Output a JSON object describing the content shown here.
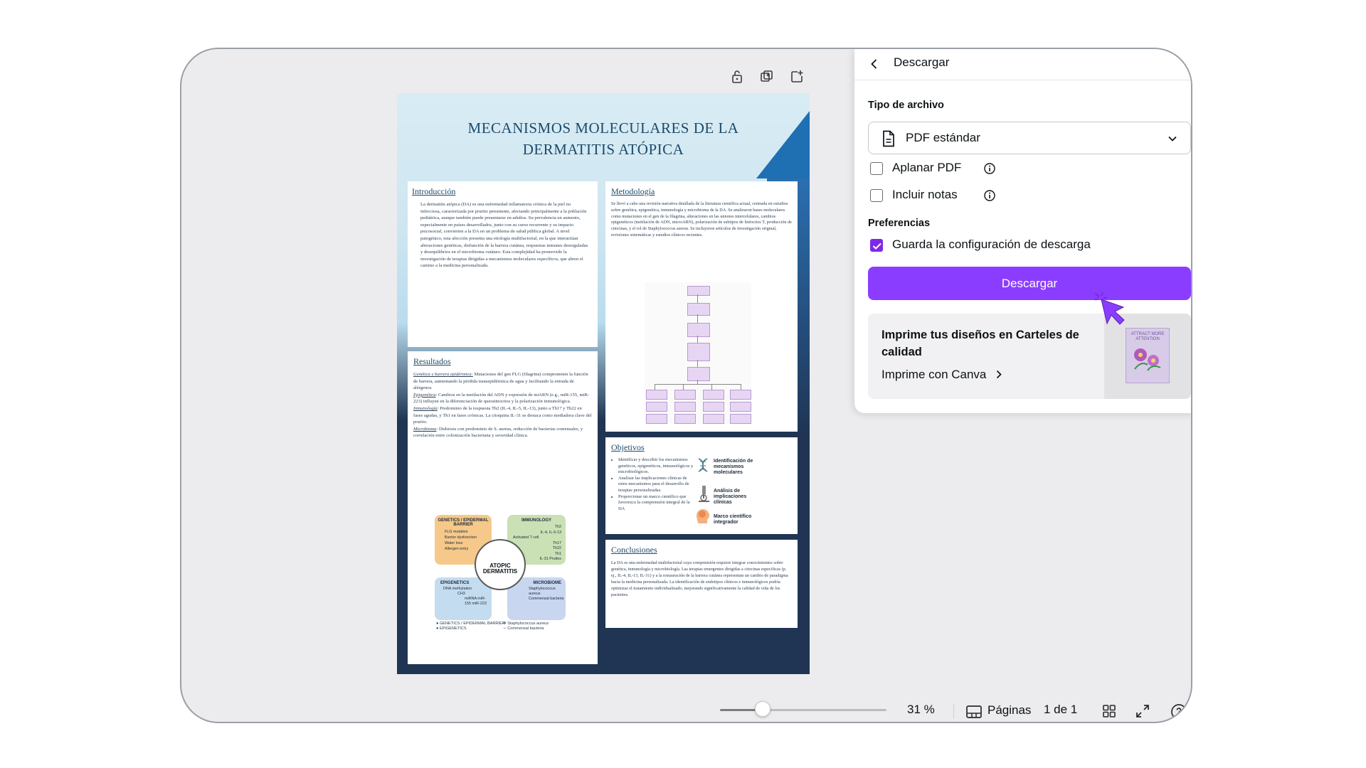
{
  "poster": {
    "title_line1": "MECANISMOS MOLECULARES DE LA",
    "title_line2": "DERMATITIS ATÓPICA",
    "intro": {
      "heading": "Introducción",
      "text": "La dermatitis atópica (DA) es una enfermedad inflamatoria crónica de la piel no infecciosa, caracterizada por prurito persistente, afectando principalmente a la población pediátrica, aunque también puede presentarse en adultos. Su prevalencia en aumento, especialmente en países desarrollados, junto con su curso recurrente y su impacto psicosocial, convierten a la DA en un problema de salud pública global. A nivel patogénico, esta afección presenta una etiología multifactorial, en la que interactúan alteraciones genéticas, disfunción de la barrera cutánea, respuestas inmunes desreguladas y desequilibrios en el microbioma cutáneo. Esta complejidad ha promovido la investigación de terapias dirigidas a mecanismos moleculares específicos, que abren el camino a la medicina personalizada."
    },
    "metodologia": {
      "heading": "Metodología",
      "text": "Se llevó a cabo una revisión narrativa detallada de la literatura científica actual, centrada en estudios sobre genética, epigenética, inmunología y microbioma de la DA. Se analizaron bases moleculares como mutaciones en el gen de la filagrina, alteraciones en las uniones intercelulares, cambios epigenéticos (metilación de ADN, microARN), polarización de subtipos de linfocitos T, producción de citocinas, y el rol de Staphylococcus aureus. Se incluyeron artículos de investigación original, revisiones sistemáticas y estudios clínicos recientes."
    },
    "resultados": {
      "heading": "Resultados",
      "items": [
        {
          "term": "Genética y barrera epidérmica:",
          "text": " Mutaciones del gen FLG (filagrina) comprometen la función de barrera, aumentando la pérdida transepidérmica de agua y facilitando la entrada de alérgenos."
        },
        {
          "term": "Epigenética",
          "text": ": Cambios en la metilación del ADN y expresión de miARN (e.g., miR-155, miR-223) influyen en la diferenciación de queratinocitos y la polarización inmunológica."
        },
        {
          "term": "Inmunología",
          "text": ": Predominio de la respuesta Th2 (IL-4, IL-5, IL-13), junto a Th17 y Th22 en fases agudas, y Th1 en fases crónicas. La citoquina IL-31 se destaca como mediadora clave del prurito."
        },
        {
          "term": "Microbioma",
          "text": ": Disbiosis con predominio de S. aureus, reducción de bacterias comensales, y correlación entre colonización bacteriana y severidad clínica."
        }
      ],
      "diagram": {
        "genetics": "GENETICS / EPIDERMAL BARRIER",
        "genetics_items": [
          "FLG mutation",
          "Barrier dysfunction",
          "Water loss",
          "Allergen entry"
        ],
        "immunology": "IMMUNOLOGY",
        "immunology_items": [
          "Th2",
          "IL-4, IL-5-13",
          "Activated T cell",
          "Th17",
          "Th22",
          "Th1",
          "IL-31 Pruitos"
        ],
        "center_line1": "ATOPIC",
        "center_line2": "DERMATITIS",
        "epigenetics": "EPIGENETICS",
        "epigenetics_items": [
          "DNA methylation",
          "CH3",
          "miRNA miR-155 miR-223"
        ],
        "microbiome": "MICROBIOME",
        "microbiome_items": [
          "Staphylococcus aureus",
          "Commensal bacteria"
        ],
        "legend": [
          "GENETICS / EPIDERMAL BARRIER",
          "EPIGENETICS",
          "Staphylococcus aureus",
          "Commensal bacteria"
        ]
      }
    },
    "objetivos": {
      "heading": "Objetivos",
      "items": [
        "Identificar y describir los mecanismos genéticos, epigenéticos, inmunológicos y microbiológicos.",
        "Analizar las implicaciones clínicas de estos mecanismos para el desarrollo de terapias personalizadas.",
        "Proporcionar un marco científico que favorezca la comprensión integral de la DA"
      ],
      "steps": [
        "Identificación de mecanismos moleculares",
        "Análisis de implicaciones clínicas",
        "Marco científico integrador"
      ]
    },
    "conclusiones": {
      "heading": "Conclusiones",
      "text": "La DA es una enfermedad multifactorial cuya comprensión requiere integrar conocimientos sobre genética, inmunología y microbiología. Las terapias emergentes dirigidas a citocinas específicas (p. ej., IL-4, IL-13, IL-31) y a la restauración de la barrera cutánea representan un cambio de paradigma hacia la medicina personalizada. La identificación de endotipos clínicos e inmunológicos podría optimizar el tratamiento individualizado, mejorando significativamente la calidad de vida de los pacientes."
    }
  },
  "bottom_bar": {
    "zoom": "31 %",
    "zoom_fraction": 0.31,
    "pages_label": "Páginas",
    "page_count": "1 de 1"
  },
  "panel": {
    "title": "Descargar",
    "file_type_label": "Tipo de archivo",
    "file_type_value": "PDF estándar",
    "flatten_label": "Aplanar PDF",
    "flatten_checked": false,
    "notes_label": "Incluir notas",
    "notes_checked": false,
    "preferences_label": "Preferencias",
    "save_config_label": "Guarda la configuración de descarga",
    "save_config_checked": true,
    "download_button": "Descargar",
    "promo_title": "Imprime tus diseños en Carteles de calidad",
    "promo_link": "Imprime con Canva",
    "promo_thumb_text": "ATTRACT MORE ATTENTION"
  },
  "colors": {
    "accent": "#8b3dff",
    "checkbox_on": "#7d2ae8",
    "poster_navy": "#1f3553"
  }
}
